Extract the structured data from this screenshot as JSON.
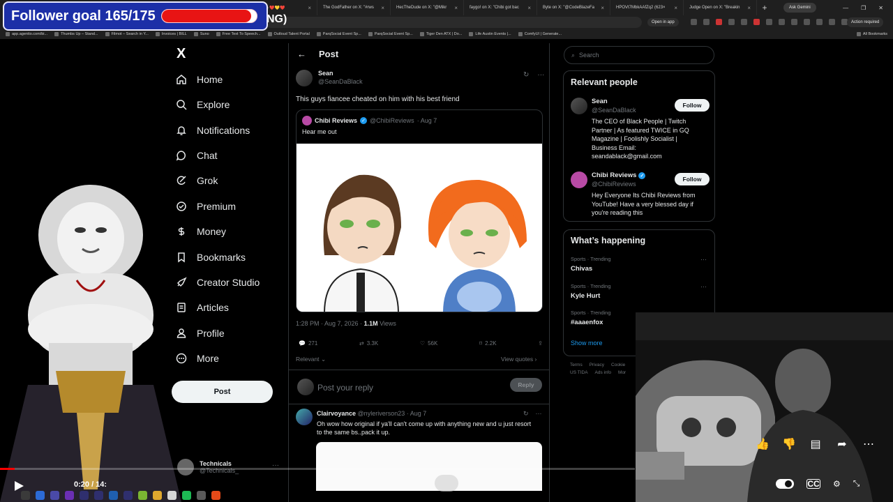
{
  "follower_goal": {
    "text": "Follower goal 165/175",
    "progress": 0.943,
    "tail_text": "NG)"
  },
  "browser": {
    "tabs": [
      {
        "label": "termoodle ❤️💛❤️"
      },
      {
        "label": "The GodFather on X: \"#rws"
      },
      {
        "label": "HecTheDude on X: \"@Mikr"
      },
      {
        "label": "faygo! on X: \"Chibi got bac"
      },
      {
        "label": "Byte on X: \"@CodeBlazeFa"
      },
      {
        "label": "HPOVt7MbkAAfZq2 (623×"
      },
      {
        "label": "Judge Open on X: \"Breakin"
      }
    ],
    "new_tab": "+",
    "ask_gemini": "Ask Gemini",
    "open_in_app": "Open in app",
    "action_required": "Action required",
    "bookmarks": [
      "app.agentio.com/bi...",
      "Thumbs Up – Stand...",
      "Filmot – Search in Y...",
      "Invoices | BILL",
      "Suno",
      "Free Text To Speech...",
      "Outloud Talent Portal",
      "ParqSocial Event Sp...",
      "ParqSocial Event Sp...",
      "Tiger Den ATX | Do...",
      "Life Austin Events |...",
      "ComfyUI | Generate..."
    ],
    "all_bookmarks": "All Bookmarks"
  },
  "nav": {
    "logo": "X",
    "items": [
      {
        "label": "Home",
        "icon": "home-icon"
      },
      {
        "label": "Explore",
        "icon": "search-icon"
      },
      {
        "label": "Notifications",
        "icon": "bell-icon"
      },
      {
        "label": "Chat",
        "icon": "chat-icon"
      },
      {
        "label": "Grok",
        "icon": "grok-icon"
      },
      {
        "label": "Premium",
        "icon": "premium-icon"
      },
      {
        "label": "Money",
        "icon": "money-icon"
      },
      {
        "label": "Bookmarks",
        "icon": "bookmark-icon"
      },
      {
        "label": "Creator Studio",
        "icon": "rocket-icon"
      },
      {
        "label": "Articles",
        "icon": "articles-icon"
      },
      {
        "label": "Profile",
        "icon": "profile-icon"
      },
      {
        "label": "More",
        "icon": "more-icon"
      }
    ],
    "post_button": "Post",
    "account": {
      "name": "Technicals",
      "handle": "@Technicals_"
    }
  },
  "post": {
    "header": "Post",
    "author": {
      "name": "Sean",
      "handle": "@SeanDaBlack"
    },
    "text": "This guys fiancee cheated on him with his best friend",
    "quote": {
      "name": "Chibi Reviews",
      "handle": "@ChibiReviews",
      "date": "· Aug 7",
      "text": "Hear me out"
    },
    "meta": {
      "time": "1:28 PM · Aug 7, 2026 · ",
      "views": "1.1M",
      "views_label": " Views"
    },
    "stats": {
      "replies": "271",
      "reposts": "3.3K",
      "likes": "56K",
      "bookmarks": "2.2K"
    },
    "relevant": "Relevant",
    "view_quotes": "View quotes",
    "reply_placeholder": "Post your reply",
    "reply_button": "Reply"
  },
  "replies": [
    {
      "name": "Clairvoyance",
      "handle": "@nyleriverson23",
      "date": "· Aug 7",
      "text": "Oh wow how original if ya'll can't come up with anything new and u just resort to the same bs..pack it up."
    }
  ],
  "right": {
    "search_placeholder": "Search",
    "relevant_title": "Relevant people",
    "people": [
      {
        "name": "Sean",
        "handle": "@SeanDaBlack",
        "bio": "The CEO of Black People | Twitch Partner | As featured TWICE in GQ Magazine | Foolishly Socialist | Business Email: seandablack@gmail.com",
        "follow": "Follow",
        "verified": false
      },
      {
        "name": "Chibi Reviews",
        "handle": "@ChibiReviews",
        "bio": "Hey Everyone Its Chibi Reviews from YouTube! Have a very blessed day if you're reading this",
        "follow": "Follow",
        "verified": true
      }
    ],
    "happening_title": "What’s happening",
    "trends": [
      {
        "category": "Sports · Trending",
        "title": "Chivas"
      },
      {
        "category": "Sports · Trending",
        "title": "Kyle Hurt"
      },
      {
        "category": "Sports · Trending",
        "title": "#aaaenfox"
      }
    ],
    "show_more": "Show more",
    "footer": [
      "Terms",
      "Privacy",
      "Cookie",
      "US TIDA",
      "Ads info",
      "Mor"
    ]
  },
  "player": {
    "time": "0:20 / 14:",
    "progress": 0.023
  },
  "colors": {
    "accent": "#1d9bf0",
    "goal_bg": "#1c2fa7",
    "goal_fill": "#e81414",
    "progress": "#ff0000"
  }
}
